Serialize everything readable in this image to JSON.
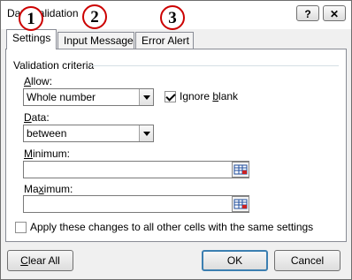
{
  "window": {
    "title": "Data Validation",
    "help_label": "?",
    "close_label": "✕"
  },
  "tabs": [
    {
      "label": "Settings",
      "active": true,
      "marker": "1"
    },
    {
      "label": "Input Message",
      "active": false,
      "marker": "2"
    },
    {
      "label": "Error Alert",
      "active": false,
      "marker": "3"
    }
  ],
  "criteria": {
    "header": "Validation criteria",
    "allow_label": "Allow:",
    "allow_value": "Whole number",
    "ignore_blank_label": "Ignore blank",
    "ignore_blank_checked": true,
    "data_label": "Data:",
    "data_value": "between",
    "minimum_label": "Minimum:",
    "minimum_value": "",
    "maximum_label": "Maximum:",
    "maximum_value": "",
    "apply_all_label": "Apply these changes to all other cells with the same settings",
    "apply_all_checked": false
  },
  "buttons": {
    "clear_all": "Clear All",
    "ok": "OK",
    "cancel": "Cancel"
  },
  "colors": {
    "marker_border": "#cc0000",
    "default_button_border": "#3c7fb1"
  },
  "icons": {
    "range_selector": "range-selector-icon",
    "dropdown": "chevron-down-icon"
  }
}
